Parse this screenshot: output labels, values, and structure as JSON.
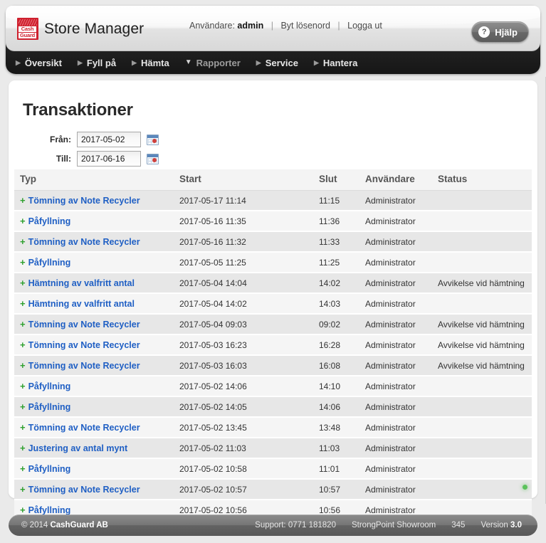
{
  "app": {
    "brand_line1": "Cash",
    "brand_line2": "Guard",
    "title": "Store Manager",
    "accent_red": "#cf202e",
    "link_blue": "#1f5fc4",
    "plus_green": "#2ea02e"
  },
  "header": {
    "user_label": "Användare:",
    "user_name": "admin",
    "change_password": "Byt lösenord",
    "logout": "Logga ut",
    "separator": "|",
    "help_label": "Hjälp",
    "help_icon": "question-mark-icon"
  },
  "nav": {
    "items": [
      {
        "label": "Översikt",
        "active": false,
        "icon": "chevron-right-icon"
      },
      {
        "label": "Fyll på",
        "active": false,
        "icon": "chevron-right-icon"
      },
      {
        "label": "Hämta",
        "active": false,
        "icon": "chevron-right-icon"
      },
      {
        "label": "Rapporter",
        "active": true,
        "icon": "chevron-down-icon"
      },
      {
        "label": "Service",
        "active": false,
        "icon": "chevron-right-icon"
      },
      {
        "label": "Hantera",
        "active": false,
        "icon": "chevron-right-icon"
      }
    ]
  },
  "page": {
    "title": "Transaktioner",
    "filters": {
      "from_label": "Från:",
      "from_value": "2017-05-02",
      "to_label": "Till:",
      "to_value": "2017-06-16",
      "calendar_icon": "calendar-icon"
    },
    "status_indicator": "green-status-dot"
  },
  "table": {
    "columns": [
      "Typ",
      "Start",
      "Slut",
      "Användare",
      "Status"
    ],
    "expand_glyph": "+",
    "rows": [
      {
        "typ": "Tömning av Note Recycler",
        "start": "2017-05-17 11:14",
        "slut": "11:15",
        "anvandare": "Administrator",
        "status": ""
      },
      {
        "typ": "Påfyllning",
        "start": "2017-05-16 11:35",
        "slut": "11:36",
        "anvandare": "Administrator",
        "status": ""
      },
      {
        "typ": "Tömning av Note Recycler",
        "start": "2017-05-16 11:32",
        "slut": "11:33",
        "anvandare": "Administrator",
        "status": ""
      },
      {
        "typ": "Påfyllning",
        "start": "2017-05-05 11:25",
        "slut": "11:25",
        "anvandare": "Administrator",
        "status": ""
      },
      {
        "typ": "Hämtning av valfritt antal",
        "start": "2017-05-04 14:04",
        "slut": "14:02",
        "anvandare": "Administrator",
        "status": "Avvikelse vid hämtning"
      },
      {
        "typ": "Hämtning av valfritt antal",
        "start": "2017-05-04 14:02",
        "slut": "14:03",
        "anvandare": "Administrator",
        "status": ""
      },
      {
        "typ": "Tömning av Note Recycler",
        "start": "2017-05-04 09:03",
        "slut": "09:02",
        "anvandare": "Administrator",
        "status": "Avvikelse vid hämtning"
      },
      {
        "typ": "Tömning av Note Recycler",
        "start": "2017-05-03 16:23",
        "slut": "16:28",
        "anvandare": "Administrator",
        "status": "Avvikelse vid hämtning"
      },
      {
        "typ": "Tömning av Note Recycler",
        "start": "2017-05-03 16:03",
        "slut": "16:08",
        "anvandare": "Administrator",
        "status": "Avvikelse vid hämtning"
      },
      {
        "typ": "Påfyllning",
        "start": "2017-05-02 14:06",
        "slut": "14:10",
        "anvandare": "Administrator",
        "status": ""
      },
      {
        "typ": "Påfyllning",
        "start": "2017-05-02 14:05",
        "slut": "14:06",
        "anvandare": "Administrator",
        "status": ""
      },
      {
        "typ": "Tömning av Note Recycler",
        "start": "2017-05-02 13:45",
        "slut": "13:48",
        "anvandare": "Administrator",
        "status": ""
      },
      {
        "typ": "Justering av antal mynt",
        "start": "2017-05-02 11:03",
        "slut": "11:03",
        "anvandare": "Administrator",
        "status": ""
      },
      {
        "typ": "Påfyllning",
        "start": "2017-05-02 10:58",
        "slut": "11:01",
        "anvandare": "Administrator",
        "status": ""
      },
      {
        "typ": "Tömning av Note Recycler",
        "start": "2017-05-02 10:57",
        "slut": "10:57",
        "anvandare": "Administrator",
        "status": ""
      },
      {
        "typ": "Påfyllning",
        "start": "2017-05-02 10:56",
        "slut": "10:56",
        "anvandare": "Administrator",
        "status": ""
      }
    ]
  },
  "footer": {
    "copyright_prefix": "© 2014 ",
    "copyright_company": "CashGuard AB",
    "support": "Support: 0771 181820",
    "site": "StrongPoint Showroom",
    "site_number": "345",
    "version_label": "Version ",
    "version_value": "3.0"
  }
}
